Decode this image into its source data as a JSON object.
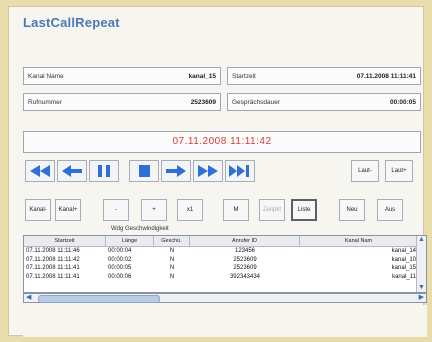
{
  "app": {
    "title": "LastCallRepeat"
  },
  "info": {
    "kanal_name_label": "Kanal Name",
    "kanal_name_value": "kanal_15",
    "startzeit_label": "Startzeit",
    "startzeit_value": "07.11.2008 11:11:41",
    "rufnummer_label": "Rufnummer",
    "rufnummer_value": "2523609",
    "gespraechsdauer_label": "Gesprächsdauer",
    "gespraechsdauer_value": "00:00:05"
  },
  "clock": "07.11.2008 11:11:42",
  "volume": {
    "down": "Laut-",
    "up": "Laut+"
  },
  "controls": {
    "kanal_minus": "Kanal-",
    "kanal_plus": "Kanal+",
    "minus": "-",
    "plus": "+",
    "x1": "x1",
    "m": "M",
    "zeitpunkt": "Zeitpkt",
    "liste": "Liste",
    "neu": "Neu",
    "aus": "Aus",
    "speed_label": "Wdg Geschwindigkeit"
  },
  "table": {
    "columns": [
      "Startzeit",
      "Länge",
      "Geschü.",
      "Anrufer ID",
      "Kanal Nam"
    ],
    "rows": [
      [
        "07.11.2008 11:11:46",
        "00:00:04",
        "N",
        "123456",
        "kanal_14"
      ],
      [
        "07.11.2008 11:11:42",
        "00:00:02",
        "N",
        "2523609",
        "kanal_10"
      ],
      [
        "07.11.2008 11:11:41",
        "00:00:05",
        "N",
        "2523609",
        "kanal_15"
      ],
      [
        "07.11.2008 11:11:41",
        "00:00:06",
        "N",
        "392343434",
        "kanal_11"
      ]
    ]
  },
  "colors": {
    "title": "#4a78b5",
    "clock": "#d43d33",
    "transport": "#2f6fd6"
  }
}
